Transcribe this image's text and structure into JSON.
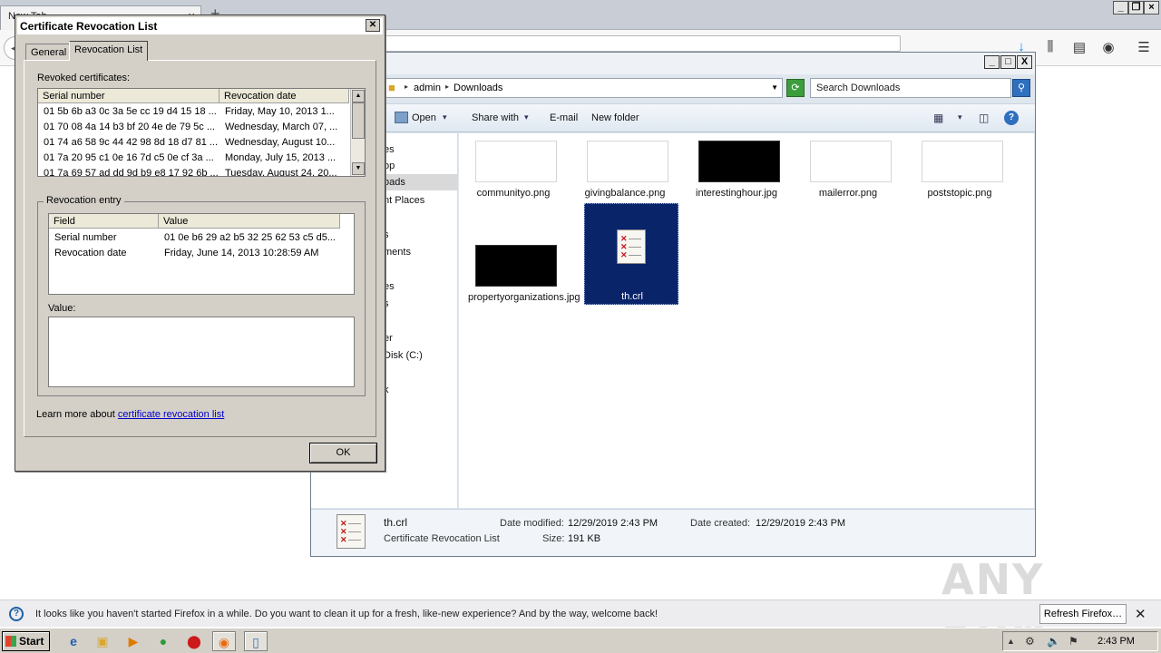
{
  "firefox": {
    "tab_title": "New Tab",
    "tab_close": "×",
    "new_tab": "+",
    "win_min": "_",
    "win_restore": "❐",
    "win_close": "×",
    "back": "◀",
    "downloads_icon": "↓",
    "library_icon": "⫼",
    "sidebar_icon": "▤",
    "account_icon": "◉",
    "menu_icon": "☰",
    "infobar": {
      "icon": "?",
      "text": "It looks like you haven't started Firefox in a while. Do you want to clean it up for a fresh, like-new experience? And by the way, welcome back!",
      "button": "Refresh Firefox…",
      "close": "✕"
    }
  },
  "explorer": {
    "address": {
      "segment1": "admin",
      "segment2": "Downloads",
      "sep": "▸",
      "drop": "▼"
    },
    "refresh": "⟳",
    "search_placeholder": "Search Downloads",
    "search_icon": "⚲",
    "win_min": "_",
    "win_max": "□",
    "win_close": "X",
    "toolbar": {
      "open": "Open",
      "open_drop": "▾",
      "share_with": "Share with",
      "share_drop": "▾",
      "email": "E-mail",
      "new_folder": "New folder",
      "views_icon": "▦",
      "views_drop": "▾",
      "preview_icon": "◫",
      "help": "?"
    },
    "nav_items": [
      "es",
      "op",
      "oads",
      "nt Places",
      "s",
      "ments",
      "es",
      "s",
      "er",
      "Disk (C:)",
      "k"
    ],
    "files": [
      {
        "name": "communityo.png"
      },
      {
        "name": "givingbalance.png"
      },
      {
        "name": "interestinghour.jpg"
      },
      {
        "name": "mailerror.png"
      },
      {
        "name": "poststopic.png"
      },
      {
        "name": "propertyorganizations.jpg"
      },
      {
        "name": "th.crl"
      }
    ],
    "details": {
      "filename": "th.crl",
      "filetype": "Certificate Revocation List",
      "date_modified_label": "Date modified:",
      "date_modified": "12/29/2019 2:43 PM",
      "date_created_label": "Date created:",
      "date_created": "12/29/2019 2:43 PM",
      "size_label": "Size:",
      "size": "191 KB"
    }
  },
  "crl_dialog": {
    "title": "Certificate Revocation List",
    "close": "✕",
    "tabs": [
      "General",
      "Revocation List"
    ],
    "revoked_label": "Revoked certificates:",
    "columns": [
      "Serial number",
      "Revocation date"
    ],
    "rows": [
      {
        "serial": "01 5b 6b a3 0c 3a 5e cc 19 d4 15 18 ...",
        "date": "Friday, May 10, 2013 1..."
      },
      {
        "serial": "01 70 08 4a 14 b3 bf 20 4e de 79 5c ...",
        "date": "Wednesday, March 07, ..."
      },
      {
        "serial": "01 74 a6 58 9c 44 42 98 8d 18 d7 81 ...",
        "date": "Wednesday, August 10..."
      },
      {
        "serial": "01 7a 20 95 c1 0e 16 7d c5 0e cf 3a ...",
        "date": "Monday, July 15, 2013 ..."
      },
      {
        "serial": "01 7a 69 57 ad dd 9d b9 e8 17 92 6b ...",
        "date": "Tuesday, August 24, 20..."
      }
    ],
    "scroll_up": "▲",
    "scroll_down": "▼",
    "entry_label": "Revocation entry",
    "entry_columns": [
      "Field",
      "Value"
    ],
    "entry_rows": [
      {
        "field": "Serial number",
        "value": "01 0e b6 29 a2 b5 32 25 62 53 c5 d5..."
      },
      {
        "field": "Revocation date",
        "value": "Friday, June 14, 2013 10:28:59 AM"
      }
    ],
    "value_label": "Value:",
    "learn_more_prefix": "Learn more about ",
    "learn_more_link": "certificate revocation list",
    "ok": "OK"
  },
  "taskbar": {
    "start": "Start",
    "apps": [
      {
        "icon": "e",
        "color": "#1e5fb4"
      },
      {
        "icon": "▣",
        "color": "#d9a630"
      },
      {
        "icon": "▶",
        "color": "#e07b00"
      },
      {
        "icon": "●",
        "color": "#2e9a3a"
      },
      {
        "icon": "⬤",
        "color": "#cc1a1a"
      },
      {
        "icon": "◉",
        "color": "#e86a10"
      },
      {
        "icon": "▯",
        "color": "#3a6fb4"
      }
    ],
    "tray_icons": [
      "▲",
      "⚙",
      "🔈",
      "⚑"
    ],
    "clock": "2:43 PM"
  },
  "watermark": "ANY RUN"
}
